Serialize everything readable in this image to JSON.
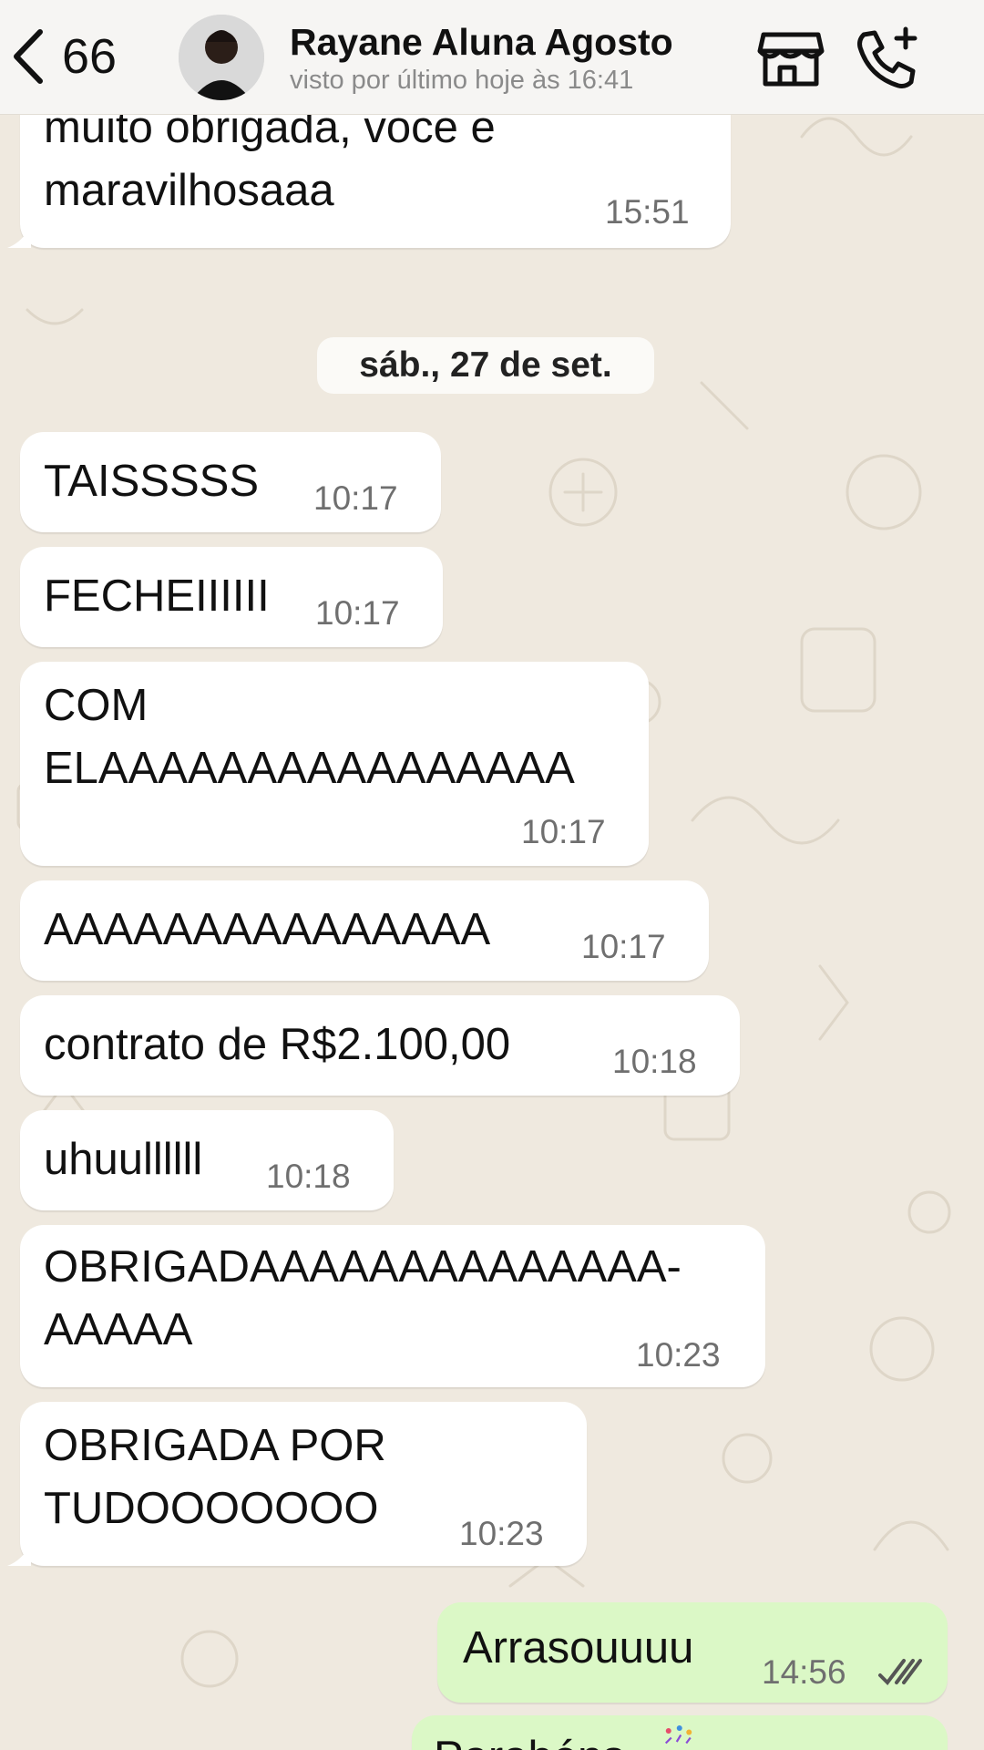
{
  "header": {
    "back_count": "66",
    "contact_name": "Rayane Aluna Agosto",
    "last_seen": "visto por último hoje às 16:41"
  },
  "date_separator": "sáb., 27 de set.",
  "messages": [
    {
      "text": "muito obrigada, voce e\nmaravilhosaaa",
      "time": "15:51",
      "dir": "in"
    },
    {
      "text": "TAISSSSS",
      "time": "10:17",
      "dir": "in"
    },
    {
      "text": "FECHEIIIIII",
      "time": "10:17",
      "dir": "in"
    },
    {
      "text": "COM\nELAAAAAAAAAAAAAAAA",
      "time": "10:17",
      "dir": "in"
    },
    {
      "text": "AAAAAAAAAAAAAAA",
      "time": "10:17",
      "dir": "in"
    },
    {
      "text": "contrato de R$2.100,00",
      "time": "10:18",
      "dir": "in"
    },
    {
      "text": "uhuullllll",
      "time": "10:18",
      "dir": "in"
    },
    {
      "text": "OBRIGADAAAAAAAAAAAAAA-\nAAAAA",
      "time": "10:23",
      "dir": "in"
    },
    {
      "text": "OBRIGADA POR\nTUDOOOOOOO",
      "time": "10:23",
      "dir": "in"
    },
    {
      "text": "Arrasouuuu",
      "time": "14:56",
      "dir": "out",
      "status": "read"
    },
    {
      "text": "Parabéns",
      "time": "",
      "dir": "out"
    }
  ],
  "icons": {
    "back": "chevron-left-icon",
    "store": "store-icon",
    "call": "call-add-icon",
    "read": "double-check-icon"
  },
  "colors": {
    "incoming_bubble": "#ffffff",
    "outgoing_bubble": "#dbf8c6",
    "wallpaper": "#efe9df"
  }
}
